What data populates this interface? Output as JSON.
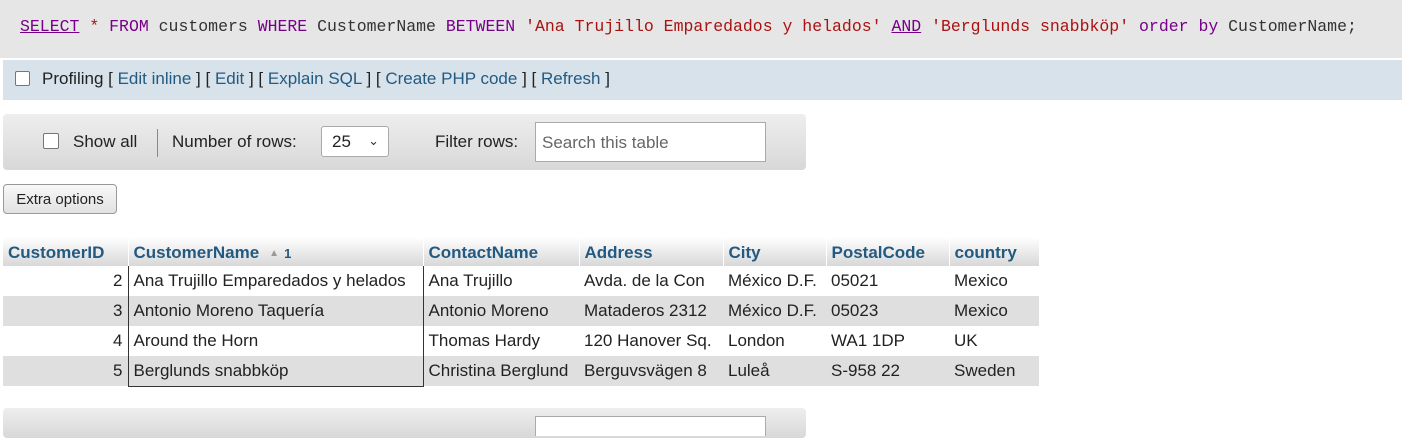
{
  "sql": {
    "select": "SELECT",
    "star": "*",
    "from": "FROM",
    "table": "customers",
    "where": "WHERE",
    "column": "CustomerName",
    "between": "BETWEEN",
    "value1": "'Ana Trujillo Emparedados y helados'",
    "and": "AND",
    "value2": "'Berglunds snabbköp'",
    "order": "order",
    "by": "by",
    "order_col": "CustomerName;"
  },
  "profiling": {
    "label": "Profiling",
    "links": [
      "Edit inline",
      "Edit",
      "Explain SQL",
      "Create PHP code",
      "Refresh"
    ]
  },
  "nav": {
    "show_all": "Show all",
    "rows_label": "Number of rows:",
    "rows_value": "25",
    "filter_label": "Filter rows:",
    "filter_placeholder": "Search this table"
  },
  "extra_options": "Extra options",
  "table": {
    "columns": [
      "CustomerID",
      "CustomerName",
      "ContactName",
      "Address",
      "City",
      "PostalCode",
      "country"
    ],
    "sort_order": "1",
    "rows": [
      [
        "2",
        "Ana Trujillo Emparedados y helados",
        "Ana Trujillo",
        "Avda. de la Con",
        "México D.F.",
        "05021",
        "Mexico"
      ],
      [
        "3",
        "Antonio Moreno Taquería",
        "Antonio Moreno",
        "Mataderos 2312",
        "México D.F.",
        "05023",
        "Mexico"
      ],
      [
        "4",
        "Around the Horn",
        "Thomas Hardy",
        "120 Hanover Sq.",
        "London",
        "WA1 1DP",
        "UK"
      ],
      [
        "5",
        "Berglunds snabbköp",
        "Christina Berglund",
        "Berguvsvägen 8",
        "Luleå",
        "S-958 22",
        "Sweden"
      ]
    ]
  },
  "colors": {
    "link": "#235a81",
    "keyword": "#770088",
    "string": "#aa1111"
  }
}
